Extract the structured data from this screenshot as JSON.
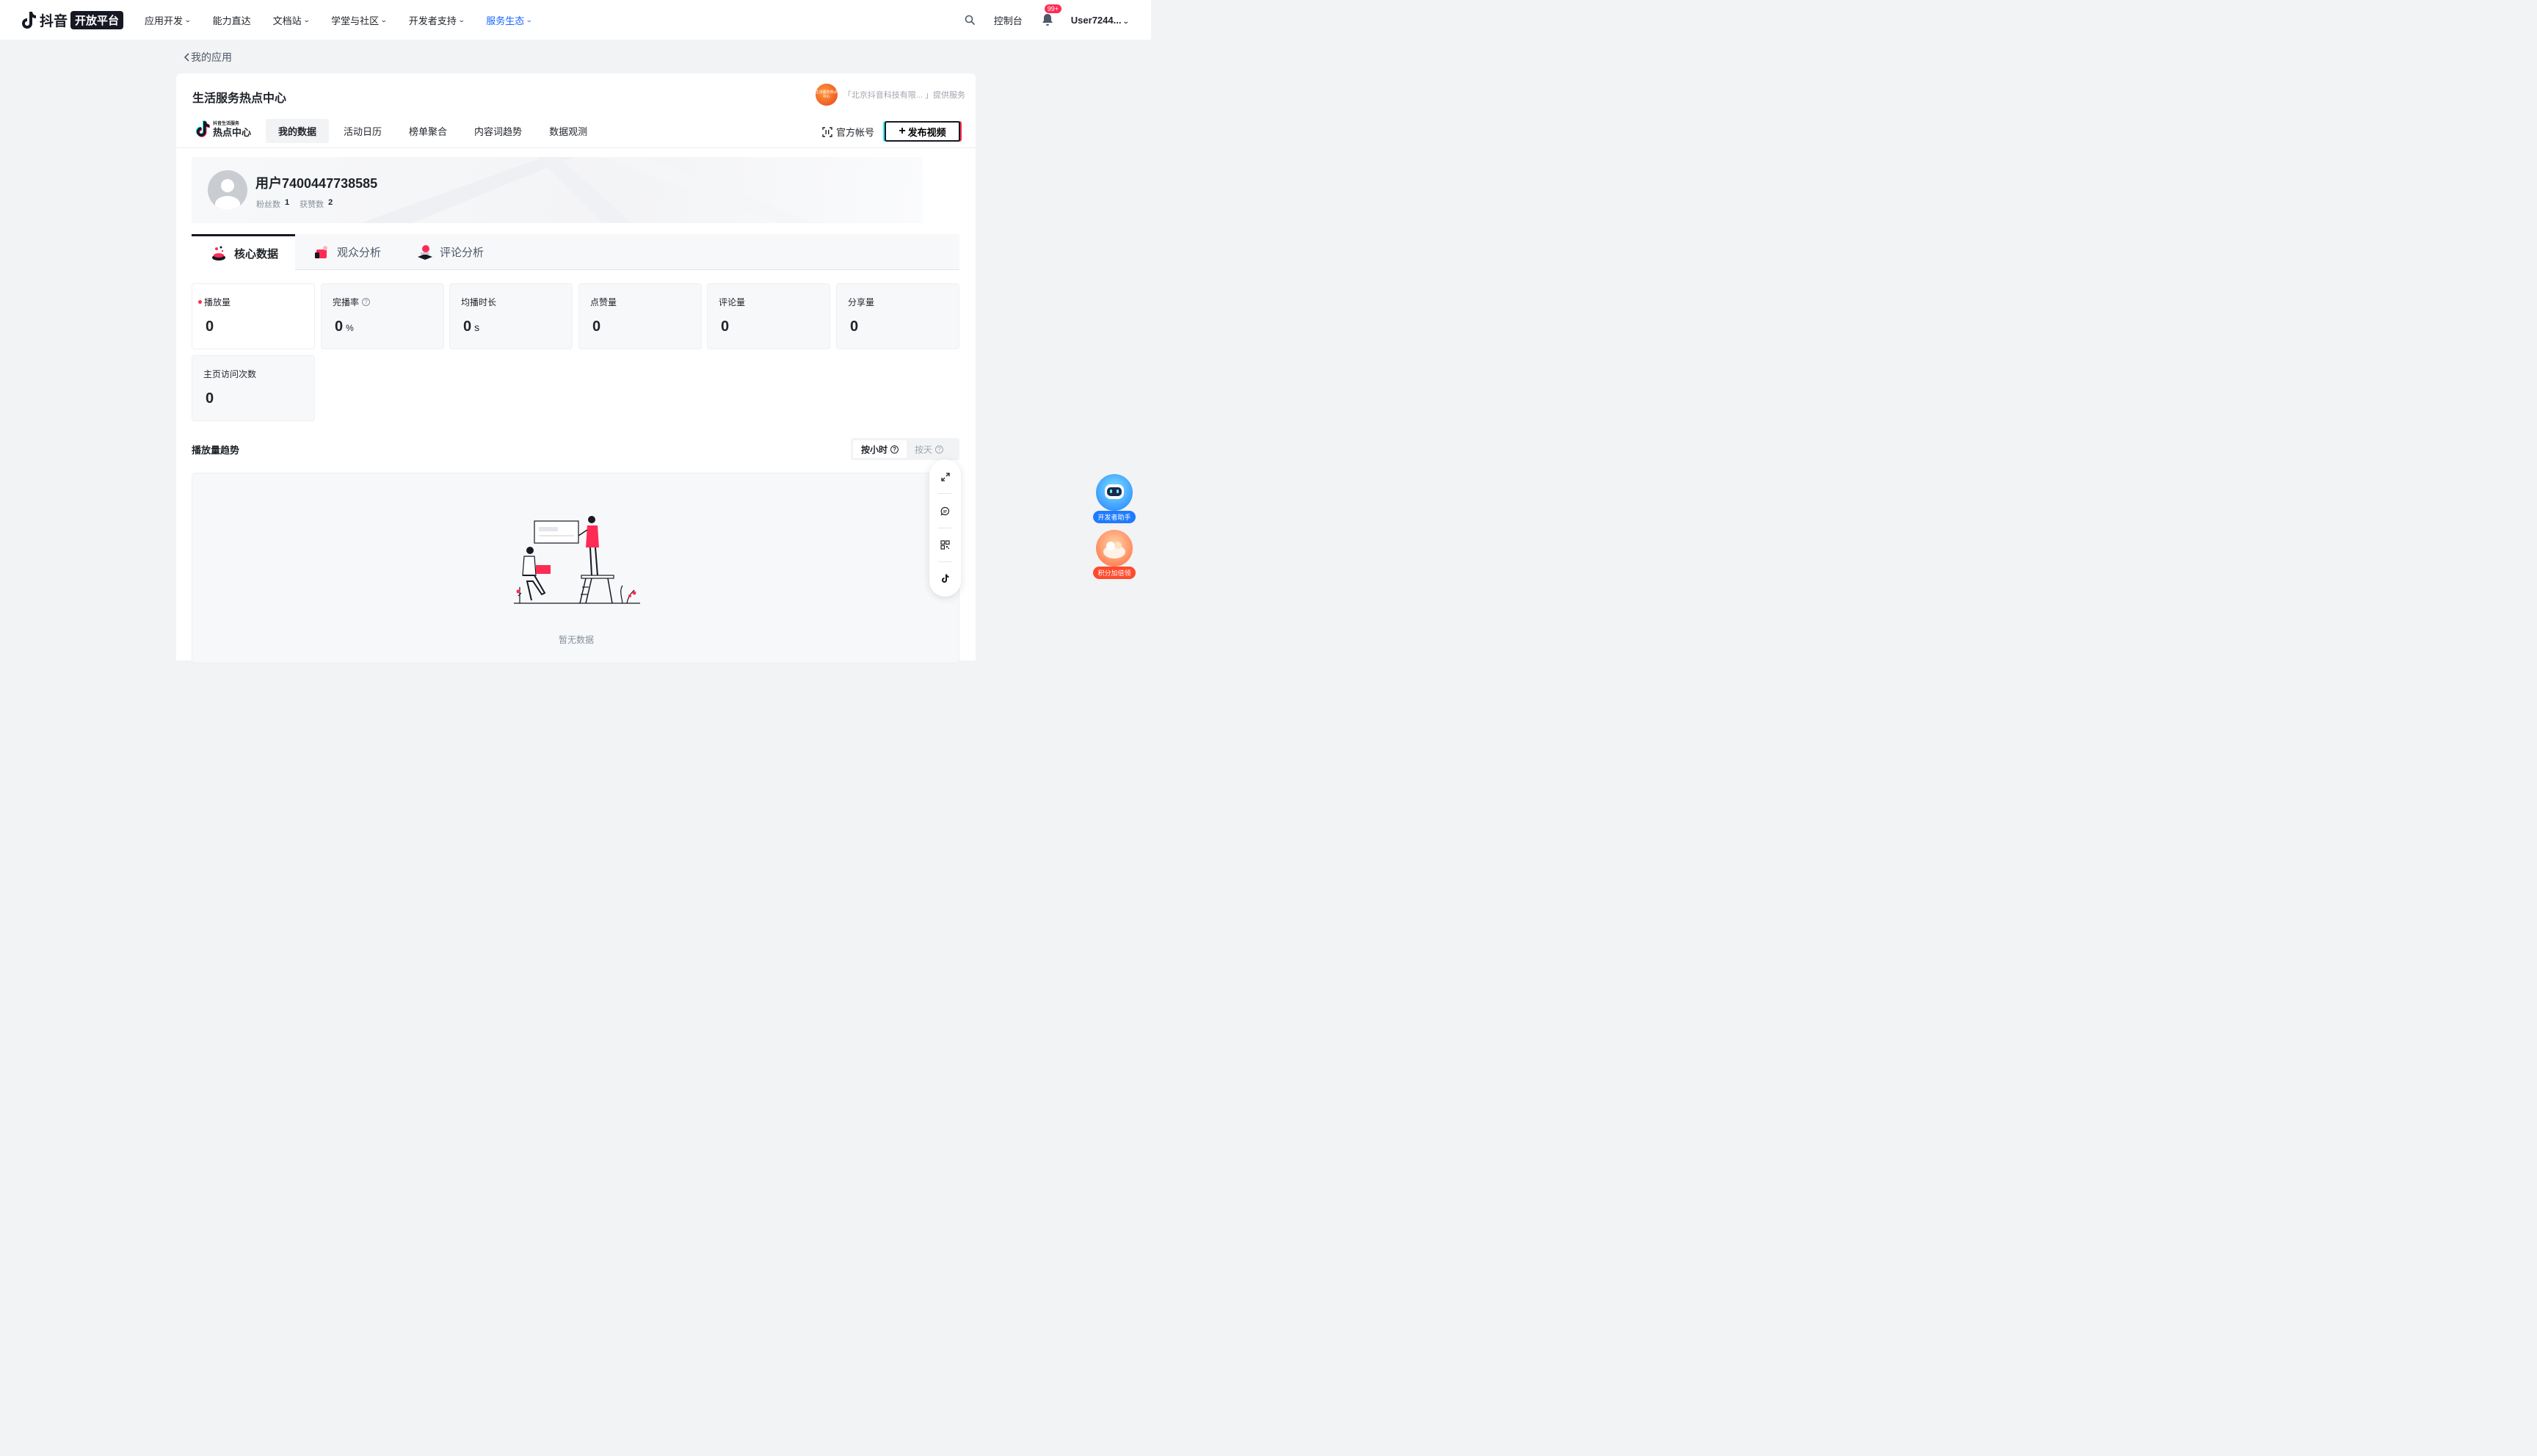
{
  "nav": {
    "logo_text": "抖音",
    "logo_badge": "开放平台",
    "items": [
      {
        "label": "应用开发",
        "caret": true
      },
      {
        "label": "能力直达",
        "caret": false
      },
      {
        "label": "文档站",
        "caret": true
      },
      {
        "label": "学堂与社区",
        "caret": true
      },
      {
        "label": "开发者支持",
        "caret": true
      },
      {
        "label": "服务生态",
        "caret": true,
        "active": true
      }
    ],
    "console": "控制台",
    "notification_badge": "99+",
    "user": "User7244..."
  },
  "back_link": "我的应用",
  "page": {
    "title": "生活服务热点中心",
    "provider_logo_text": "生活服务热点中心",
    "provider_text": "「北京抖音科技有限... 」提供服务"
  },
  "subnav": {
    "brand_small": "抖音生活服务",
    "brand_big": "热点中心",
    "tabs": [
      "我的数据",
      "活动日历",
      "榜单聚合",
      "内容词趋势",
      "数据观测"
    ],
    "active_tab": 0,
    "official_account": "官方帐号",
    "publish_button": "发布视频"
  },
  "profile": {
    "name": "用户7400447738585",
    "fans_label": "粉丝数",
    "fans_value": "1",
    "likes_label": "获赞数",
    "likes_value": "2"
  },
  "analysis_tabs": [
    "核心数据",
    "观众分析",
    "评论分析"
  ],
  "metrics": [
    {
      "label": "播放量",
      "value": "0",
      "unit": "",
      "dot": true,
      "help": false
    },
    {
      "label": "完播率",
      "value": "0",
      "unit": "%",
      "dot": false,
      "help": true
    },
    {
      "label": "均播时长",
      "value": "0",
      "unit": "s",
      "dot": false,
      "help": false
    },
    {
      "label": "点赞量",
      "value": "0",
      "unit": "",
      "dot": false,
      "help": false
    },
    {
      "label": "评论量",
      "value": "0",
      "unit": "",
      "dot": false,
      "help": false
    },
    {
      "label": "分享量",
      "value": "0",
      "unit": "",
      "dot": false,
      "help": false
    },
    {
      "label": "主页访问次数",
      "value": "0",
      "unit": "",
      "dot": false,
      "help": false
    }
  ],
  "trend": {
    "title": "播放量趋势",
    "toggle": [
      "按小时",
      "按天"
    ],
    "active_toggle": 0,
    "empty_text": "暂无数据"
  },
  "helpers": [
    {
      "label": "开发者助手",
      "color": "#1f7cff"
    },
    {
      "label": "积分加倍领",
      "color": "#ff4a2b"
    }
  ],
  "colors": {
    "accent": "#1664ff",
    "brand_red": "#fe2c55",
    "brand_cyan": "#25f4ee",
    "dark": "#161823"
  }
}
